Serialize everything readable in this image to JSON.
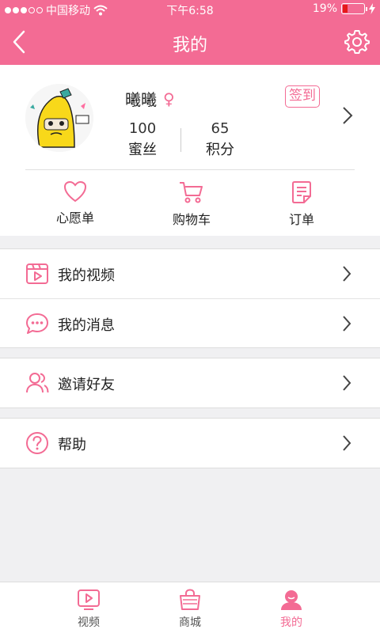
{
  "status_bar": {
    "carrier": "中国移动",
    "time": "下午6:58",
    "battery_pct": "19%"
  },
  "nav": {
    "title": "我的"
  },
  "profile": {
    "name": "曦曦",
    "gender_symbol": "♀",
    "checkin_label": "签到",
    "fans_count": "100",
    "fans_label": "蜜丝",
    "points_count": "65",
    "points_label": "积分"
  },
  "quick_links": [
    {
      "label": "心愿单",
      "icon": "heart-icon"
    },
    {
      "label": "购物车",
      "icon": "cart-icon"
    },
    {
      "label": "订单",
      "icon": "order-icon"
    }
  ],
  "menu": {
    "my_videos": "我的视频",
    "my_messages": "我的消息",
    "invite_friends": "邀请好友",
    "help": "帮助"
  },
  "tabs": [
    {
      "label": "视频",
      "icon": "video-tab-icon",
      "active": false
    },
    {
      "label": "商城",
      "icon": "shop-bag-icon",
      "active": false
    },
    {
      "label": "我的",
      "icon": "user-icon",
      "active": true
    }
  ],
  "colors": {
    "accent": "#f36b94",
    "battery_low": "#e51919",
    "background": "#f0f0f2"
  }
}
